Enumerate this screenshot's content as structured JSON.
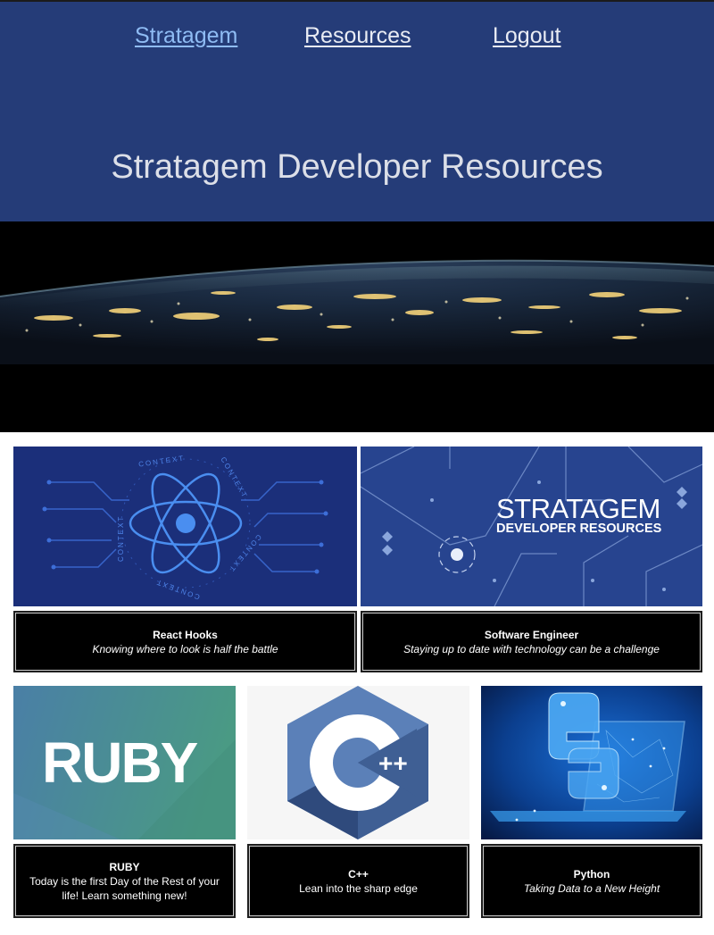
{
  "nav": {
    "links": [
      {
        "label": "Stratagem"
      },
      {
        "label": "Resources"
      },
      {
        "label": "Logout"
      }
    ]
  },
  "header": {
    "title": "Stratagem Developer Resources"
  },
  "cards": [
    {
      "title": "React Hooks",
      "subtitle": "Knowing where to look is half the battle",
      "image_text": [
        "CONTEXT"
      ]
    },
    {
      "title": "Software Engineer",
      "subtitle": "Staying up to date with technology can be a challenge",
      "image_text": [
        "STRATAGEM",
        "DEVELOPER RESOURCES"
      ]
    },
    {
      "title": "RUBY",
      "subtitle": "Today is the first Day of the Rest of your life! Learn something new!",
      "image_text": [
        "RUBY"
      ]
    },
    {
      "title": "C++",
      "subtitle": "Lean into the sharp edge",
      "image_text": [
        "C",
        "++"
      ]
    },
    {
      "title": "Python",
      "subtitle": "Taking Data to a New Height"
    }
  ],
  "colors": {
    "header_bg": "#253c78",
    "active_link": "#8fbcf4"
  }
}
